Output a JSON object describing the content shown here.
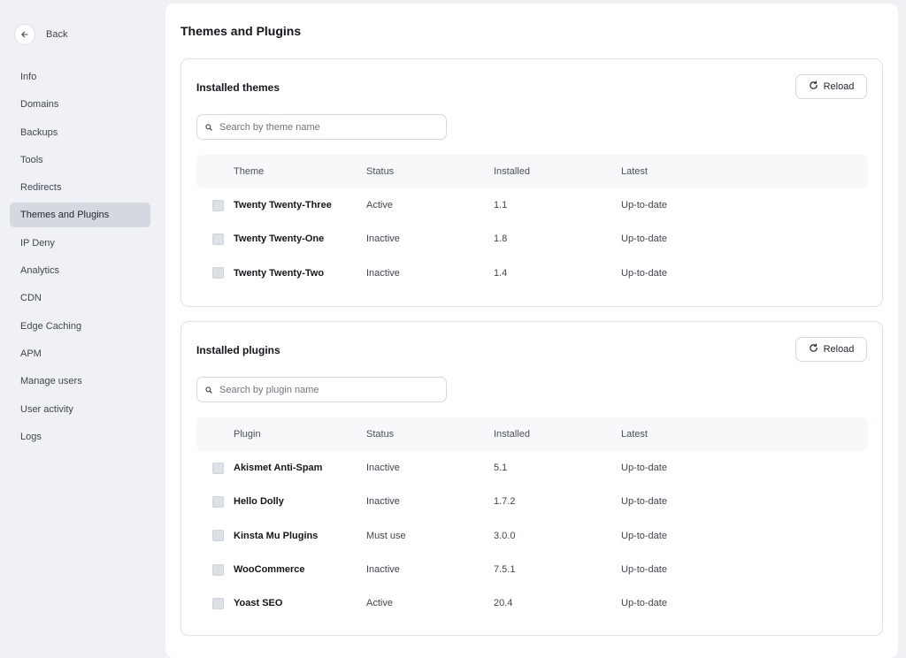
{
  "nav": {
    "back_label": "Back",
    "items": [
      {
        "label": "Info",
        "active": false
      },
      {
        "label": "Domains",
        "active": false
      },
      {
        "label": "Backups",
        "active": false
      },
      {
        "label": "Tools",
        "active": false
      },
      {
        "label": "Redirects",
        "active": false
      },
      {
        "label": "Themes and Plugins",
        "active": true
      },
      {
        "label": "IP Deny",
        "active": false
      },
      {
        "label": "Analytics",
        "active": false
      },
      {
        "label": "CDN",
        "active": false
      },
      {
        "label": "Edge Caching",
        "active": false
      },
      {
        "label": "APM",
        "active": false
      },
      {
        "label": "Manage users",
        "active": false
      },
      {
        "label": "User activity",
        "active": false
      },
      {
        "label": "Logs",
        "active": false
      }
    ]
  },
  "page": {
    "title": "Themes and Plugins"
  },
  "themes": {
    "title": "Installed themes",
    "reload_label": "Reload",
    "search_placeholder": "Search by theme name",
    "columns": {
      "name": "Theme",
      "status": "Status",
      "installed": "Installed",
      "latest": "Latest"
    },
    "rows": [
      {
        "name": "Twenty Twenty-Three",
        "status": "Active",
        "installed": "1.1",
        "latest": "Up-to-date"
      },
      {
        "name": "Twenty Twenty-One",
        "status": "Inactive",
        "installed": "1.8",
        "latest": "Up-to-date"
      },
      {
        "name": "Twenty Twenty-Two",
        "status": "Inactive",
        "installed": "1.4",
        "latest": "Up-to-date"
      }
    ]
  },
  "plugins": {
    "title": "Installed plugins",
    "reload_label": "Reload",
    "search_placeholder": "Search by plugin name",
    "columns": {
      "name": "Plugin",
      "status": "Status",
      "installed": "Installed",
      "latest": "Latest"
    },
    "rows": [
      {
        "name": "Akismet Anti-Spam",
        "status": "Inactive",
        "installed": "5.1",
        "latest": "Up-to-date"
      },
      {
        "name": "Hello Dolly",
        "status": "Inactive",
        "installed": "1.7.2",
        "latest": "Up-to-date"
      },
      {
        "name": "Kinsta Mu Plugins",
        "status": "Must use",
        "installed": "3.0.0",
        "latest": "Up-to-date"
      },
      {
        "name": "WooCommerce",
        "status": "Inactive",
        "installed": "7.5.1",
        "latest": "Up-to-date"
      },
      {
        "name": "Yoast SEO",
        "status": "Active",
        "installed": "20.4",
        "latest": "Up-to-date"
      }
    ]
  },
  "colors": {
    "active_nav_bg": "#d4d8e1",
    "page_bg": "#f0f1f4",
    "card_border": "#dfe2e8"
  }
}
